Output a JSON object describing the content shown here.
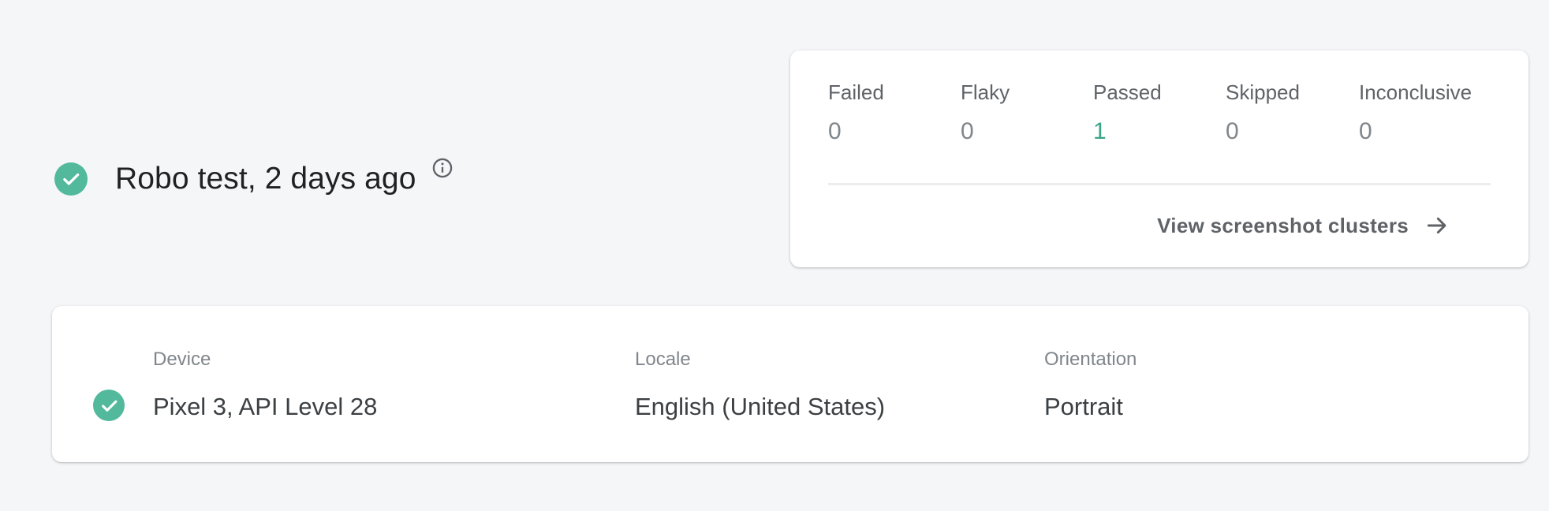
{
  "test_header": {
    "title": "Robo test, 2 days ago",
    "status_icon": "check-circle-icon",
    "info_icon": "info-icon"
  },
  "summary": {
    "stats": [
      {
        "label": "Failed",
        "value": "0"
      },
      {
        "label": "Flaky",
        "value": "0"
      },
      {
        "label": "Passed",
        "value": "1"
      },
      {
        "label": "Skipped",
        "value": "0"
      },
      {
        "label": "Inconclusive",
        "value": "0"
      }
    ],
    "clusters_link": "View screenshot clusters",
    "clusters_icon": "arrow-right-icon"
  },
  "device_row": {
    "status_icon": "check-circle-icon",
    "device_label": "Device",
    "device_value": "Pixel 3, API Level 28",
    "locale_label": "Locale",
    "locale_value": "English (United States)",
    "orientation_label": "Orientation",
    "orientation_value": "Portrait"
  },
  "colors": {
    "success": "#52b99c",
    "passed_text": "#3aa48a",
    "background": "#f5f6f8"
  }
}
